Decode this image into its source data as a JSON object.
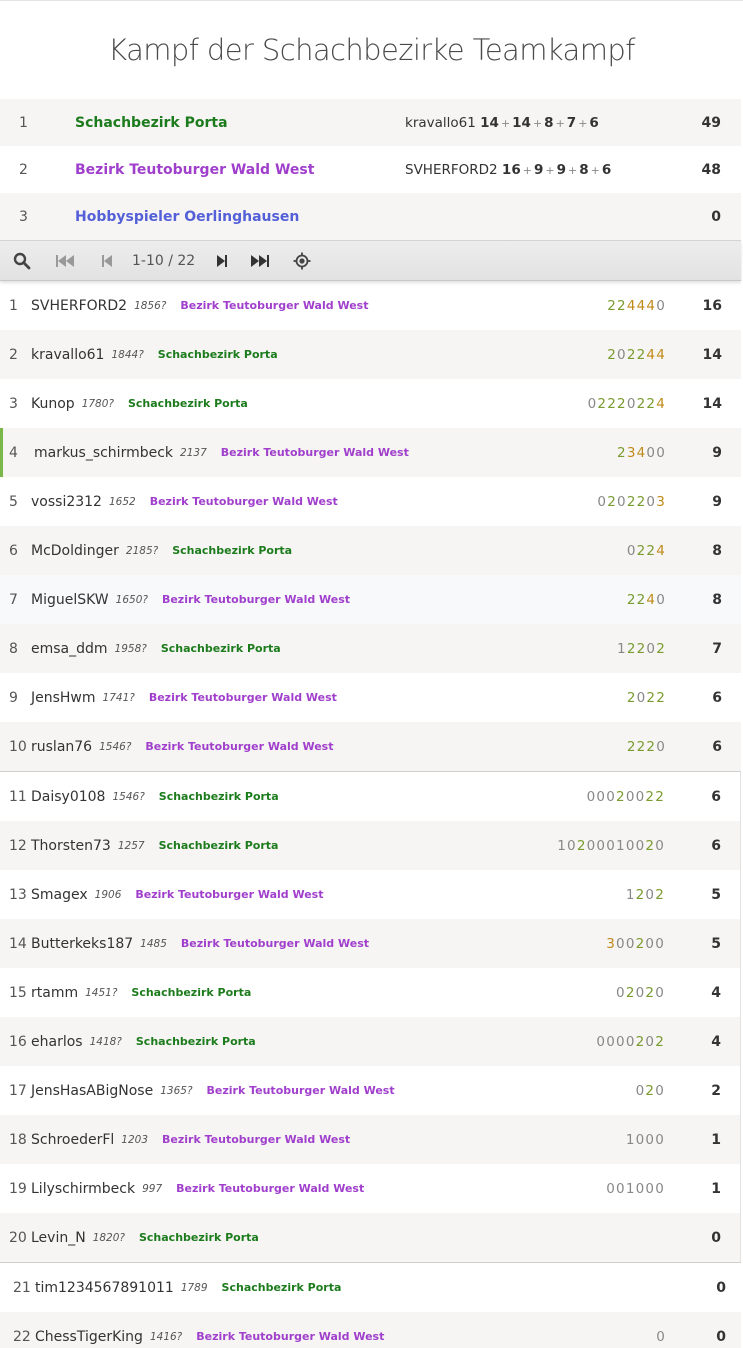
{
  "title": "Kampf der Schachbezirke Teamkampf",
  "colors": {
    "porta": "#1c7b1c",
    "teutoburg": "#a03fcc",
    "hobby": "#5460d8"
  },
  "teams": [
    {
      "rank": "1",
      "name": "Schachbezirk Porta",
      "color": "green",
      "top_player": "kravallo61",
      "top_scores": [
        "14",
        "14",
        "8",
        "7",
        "6"
      ],
      "score": "49"
    },
    {
      "rank": "2",
      "name": "Bezirk Teutoburger Wald West",
      "color": "purple",
      "top_player": "SVHERFORD2",
      "top_scores": [
        "16",
        "9",
        "9",
        "8",
        "6"
      ],
      "score": "48"
    },
    {
      "rank": "3",
      "name": "Hobbyspieler Oerlinghausen",
      "color": "blue",
      "top_player": "",
      "top_scores": [],
      "score": "0"
    }
  ],
  "pager": {
    "info": "1-10 / 22",
    "icons": [
      "search-icon",
      "first-page-icon",
      "previous-page-icon",
      "next-page-icon",
      "last-page-icon",
      "locate-me-icon"
    ]
  },
  "players": [
    {
      "rank": "1",
      "name": "SVHERFORD2",
      "rating": "1856?",
      "team": "Bezirk Teutoburger Wald West",
      "color": "purple",
      "sheet": "224440",
      "score": "16"
    },
    {
      "rank": "2",
      "name": "kravallo61",
      "rating": "1844?",
      "team": "Schachbezirk Porta",
      "color": "green",
      "sheet": "202244",
      "score": "14"
    },
    {
      "rank": "3",
      "name": "Kunop",
      "rating": "1780?",
      "team": "Schachbezirk Porta",
      "color": "green",
      "sheet": "02220224",
      "score": "14"
    },
    {
      "rank": "4",
      "name": "markus_schirmbeck",
      "rating": "2137",
      "team": "Bezirk Teutoburger Wald West",
      "color": "purple",
      "sheet": "23400",
      "score": "9"
    },
    {
      "rank": "5",
      "name": "vossi2312",
      "rating": "1652",
      "team": "Bezirk Teutoburger Wald West",
      "color": "purple",
      "sheet": "0202203",
      "score": "9"
    },
    {
      "rank": "6",
      "name": "McDoldinger",
      "rating": "2185?",
      "team": "Schachbezirk Porta",
      "color": "green",
      "sheet": "0224",
      "score": "8"
    },
    {
      "rank": "7",
      "name": "MiguelSKW",
      "rating": "1650?",
      "team": "Bezirk Teutoburger Wald West",
      "color": "purple",
      "sheet": "2240",
      "score": "8"
    },
    {
      "rank": "8",
      "name": "emsa_ddm",
      "rating": "1958?",
      "team": "Schachbezirk Porta",
      "color": "green",
      "sheet": "12202",
      "score": "7"
    },
    {
      "rank": "9",
      "name": "JensHwm",
      "rating": "1741?",
      "team": "Bezirk Teutoburger Wald West",
      "color": "purple",
      "sheet": "2022",
      "score": "6"
    },
    {
      "rank": "10",
      "name": "ruslan76",
      "rating": "1546?",
      "team": "Bezirk Teutoburger Wald West",
      "color": "purple",
      "sheet": "2220",
      "score": "6"
    },
    {
      "rank": "11",
      "name": "Daisy0108",
      "rating": "1546?",
      "team": "Schachbezirk Porta",
      "color": "green",
      "sheet": "00020022",
      "score": "6"
    },
    {
      "rank": "12",
      "name": "Thorsten73",
      "rating": "1257",
      "team": "Schachbezirk Porta",
      "color": "green",
      "sheet": "10200010020",
      "score": "6"
    },
    {
      "rank": "13",
      "name": "Smagex",
      "rating": "1906",
      "team": "Bezirk Teutoburger Wald West",
      "color": "purple",
      "sheet": "1202",
      "score": "5"
    },
    {
      "rank": "14",
      "name": "Butterkeks187",
      "rating": "1485",
      "team": "Bezirk Teutoburger Wald West",
      "color": "purple",
      "sheet": "300200",
      "score": "5"
    },
    {
      "rank": "15",
      "name": "rtamm",
      "rating": "1451?",
      "team": "Schachbezirk Porta",
      "color": "green",
      "sheet": "02020",
      "score": "4"
    },
    {
      "rank": "16",
      "name": "eharlos",
      "rating": "1418?",
      "team": "Schachbezirk Porta",
      "color": "green",
      "sheet": "0000202",
      "score": "4"
    },
    {
      "rank": "17",
      "name": "JensHasABigNose",
      "rating": "1365?",
      "team": "Bezirk Teutoburger Wald West",
      "color": "purple",
      "sheet": "020",
      "score": "2"
    },
    {
      "rank": "18",
      "name": "SchroederFl",
      "rating": "1203",
      "team": "Bezirk Teutoburger Wald West",
      "color": "purple",
      "sheet": "1000",
      "score": "1"
    },
    {
      "rank": "19",
      "name": "Lilyschirmbeck",
      "rating": "997",
      "team": "Bezirk Teutoburger Wald West",
      "color": "purple",
      "sheet": "001000",
      "score": "1"
    },
    {
      "rank": "20",
      "name": "Levin_N",
      "rating": "1820?",
      "team": "Schachbezirk Porta",
      "color": "green",
      "sheet": "",
      "score": "0"
    },
    {
      "rank": "21",
      "name": "tim1234567891011",
      "rating": "1789",
      "team": "Schachbezirk Porta",
      "color": "green",
      "sheet": "",
      "score": "0"
    },
    {
      "rank": "22",
      "name": "ChessTigerKing",
      "rating": "1416?",
      "team": "Bezirk Teutoburger Wald West",
      "color": "purple",
      "sheet": "0",
      "score": "0"
    }
  ]
}
